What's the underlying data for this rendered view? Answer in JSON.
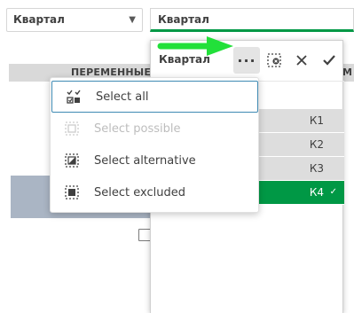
{
  "filter_pane": {
    "dropdown_label": "Квартал",
    "active_label": "Квартал"
  },
  "background_table": {
    "header_label": "ПЕРЕМЕННЫЕ П",
    "header_label2": "М"
  },
  "listbox": {
    "title": "Квартал",
    "toolbar": {
      "more_label": "···",
      "clear_icon": "clear-selections-icon",
      "cancel_icon": "close-icon",
      "confirm_icon": "checkmark-icon"
    },
    "values": [
      {
        "label": "К1",
        "state": "alternative"
      },
      {
        "label": "К2",
        "state": "alternative"
      },
      {
        "label": "К3",
        "state": "alternative"
      },
      {
        "label": "К4",
        "state": "selected"
      }
    ]
  },
  "menu": {
    "items": [
      {
        "label": "Select all",
        "icon": "select-all-icon",
        "enabled": true,
        "focused": true
      },
      {
        "label": "Select possible",
        "icon": "select-possible-icon",
        "enabled": false
      },
      {
        "label": "Select alternative",
        "icon": "select-alternative-icon",
        "enabled": true
      },
      {
        "label": "Select excluded",
        "icon": "select-excluded-icon",
        "enabled": true
      }
    ]
  },
  "colors": {
    "selected_green": "#009845",
    "alternative_gray": "#dddddd",
    "focus_blue": "#3f8ab3",
    "arrow_green": "#22e03a"
  }
}
